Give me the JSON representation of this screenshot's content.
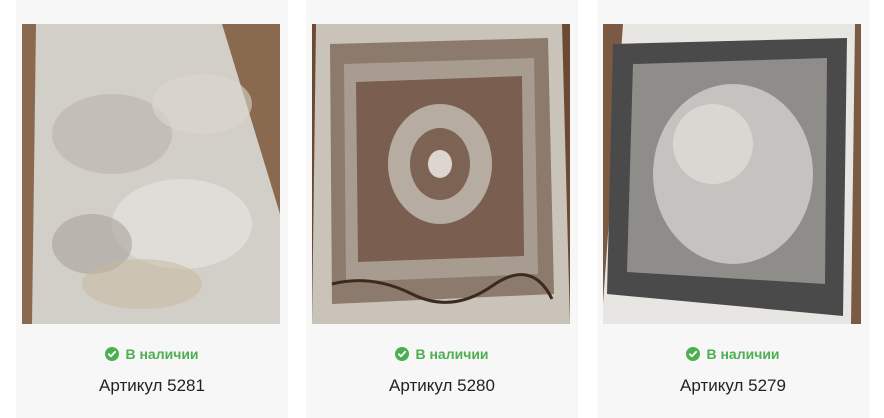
{
  "products": [
    {
      "stock_label": "В наличии",
      "title": "Артикул 5281"
    },
    {
      "stock_label": "В наличии",
      "title": "Артикул 5280"
    },
    {
      "stock_label": "В наличии",
      "title": "Артикул 5279"
    }
  ],
  "colors": {
    "stock": "#4caf50",
    "title": "#222222",
    "card_bg": "#f7f7f7"
  },
  "icons": {
    "stock": "check-circle-icon"
  }
}
